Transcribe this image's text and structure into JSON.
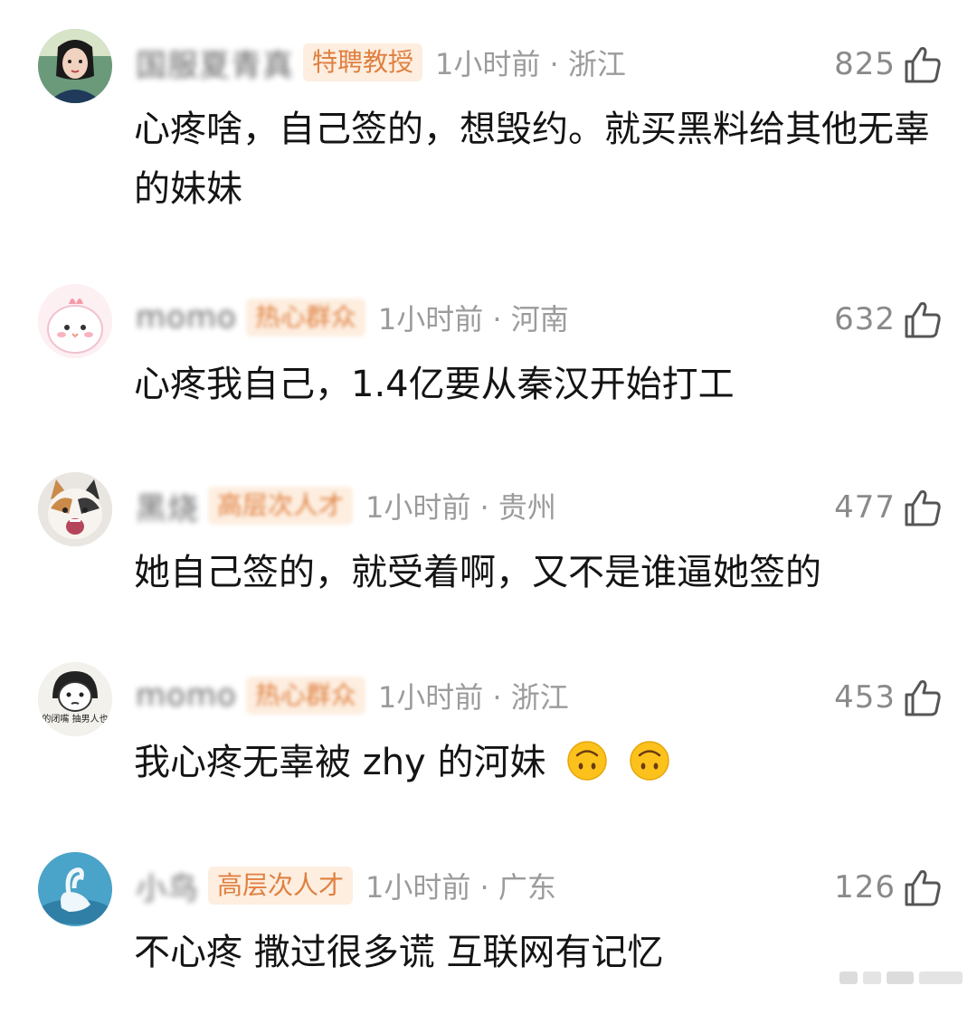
{
  "comments": [
    {
      "username": "国服夏青真",
      "badge": "特聘教授",
      "meta": "1小时前 · 浙江",
      "likes": "825",
      "text": "心疼啥，自己签的，想毁约。就买黑料给其他无辜的妹妹",
      "avatar_icon": "girl-portrait-avatar"
    },
    {
      "username": "momo",
      "badge": "热心群众",
      "meta": "1小时前 · 河南",
      "likes": "632",
      "text": "心疼我自己，1.4亿要从秦汉开始打工",
      "avatar_icon": "pink-chick-avatar"
    },
    {
      "username": "黑烧",
      "badge": "高层次人才",
      "meta": "1小时前 · 贵州",
      "likes": "477",
      "text": "她自己签的，就受着啊，又不是谁逼她签的",
      "avatar_icon": "screaming-cat-avatar"
    },
    {
      "username": "momo",
      "badge": "热心群众",
      "meta": "1小时前 · 浙江",
      "likes": "453",
      "text": "我心疼无辜被 zhy 的河妹",
      "avatar_icon": "cartoon-girl-avatar",
      "avatar_caption": "男的闭嘴 抽男人也闭",
      "emoji": [
        "upside-down-face-emoji",
        "upside-down-face-emoji"
      ]
    },
    {
      "username": "小鸟",
      "badge": "高层次人才",
      "meta": "1小时前 · 广东",
      "likes": "126",
      "text": "不心疼 撒过很多谎 互联网有记忆",
      "avatar_icon": "swan-avatar"
    }
  ],
  "colors": {
    "badge_bg": "#fdeee0",
    "badge_text": "#e08040",
    "meta_text": "#9b9b9b",
    "body_text": "#141414"
  }
}
